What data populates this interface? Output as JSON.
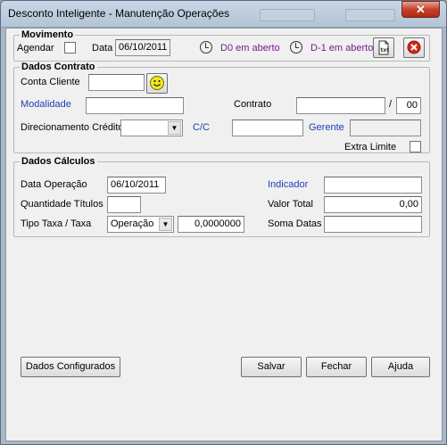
{
  "window": {
    "title": "Desconto Inteligente - Manutenção Operações",
    "close_label": "✕"
  },
  "movimento": {
    "legend": "Movimento",
    "agendar_label": "Agendar",
    "data_label": "Data",
    "data_value": "06/10/2011",
    "d0_label": "D0 em aberto",
    "d1_label": "D-1 em aberto"
  },
  "dados_contrato": {
    "legend": "Dados Contrato",
    "conta_cliente_label": "Conta Cliente",
    "conta_cliente_value": "",
    "modalidade_label": "Modalidade",
    "modalidade_value": "",
    "contrato_label": "Contrato",
    "contrato_value": "",
    "contrato_sep": "/",
    "contrato_suffix_value": "00",
    "direcionamento_label": "Direcionamento Crédito",
    "direcionamento_value": "",
    "cc_label": "C/C",
    "cc_value": "",
    "gerente_label": "Gerente",
    "gerente_value": "",
    "extra_limite_label": "Extra Limite"
  },
  "dados_calculos": {
    "legend": "Dados Cálculos",
    "data_operacao_label": "Data Operação",
    "data_operacao_value": "06/10/2011",
    "indicador_label": "Indicador",
    "indicador_value": "",
    "quantidade_titulos_label": "Quantidade Títulos",
    "quantidade_titulos_value": "",
    "valor_total_label": "Valor Total",
    "valor_total_value": "0,00",
    "tipo_taxa_label": "Tipo Taxa / Taxa",
    "tipo_taxa_value": "Operação",
    "taxa_value": "0,0000000",
    "soma_datas_label": "Soma Datas",
    "soma_datas_value": ""
  },
  "buttons": {
    "dados_configurados": "Dados Configurados",
    "salvar": "Salvar",
    "fechar": "Fechar",
    "ajuda": "Ajuda"
  },
  "colors": {
    "link_blue": "#1e3fb5",
    "purple": "#7a1a8c",
    "close_red": "#c7402a"
  }
}
